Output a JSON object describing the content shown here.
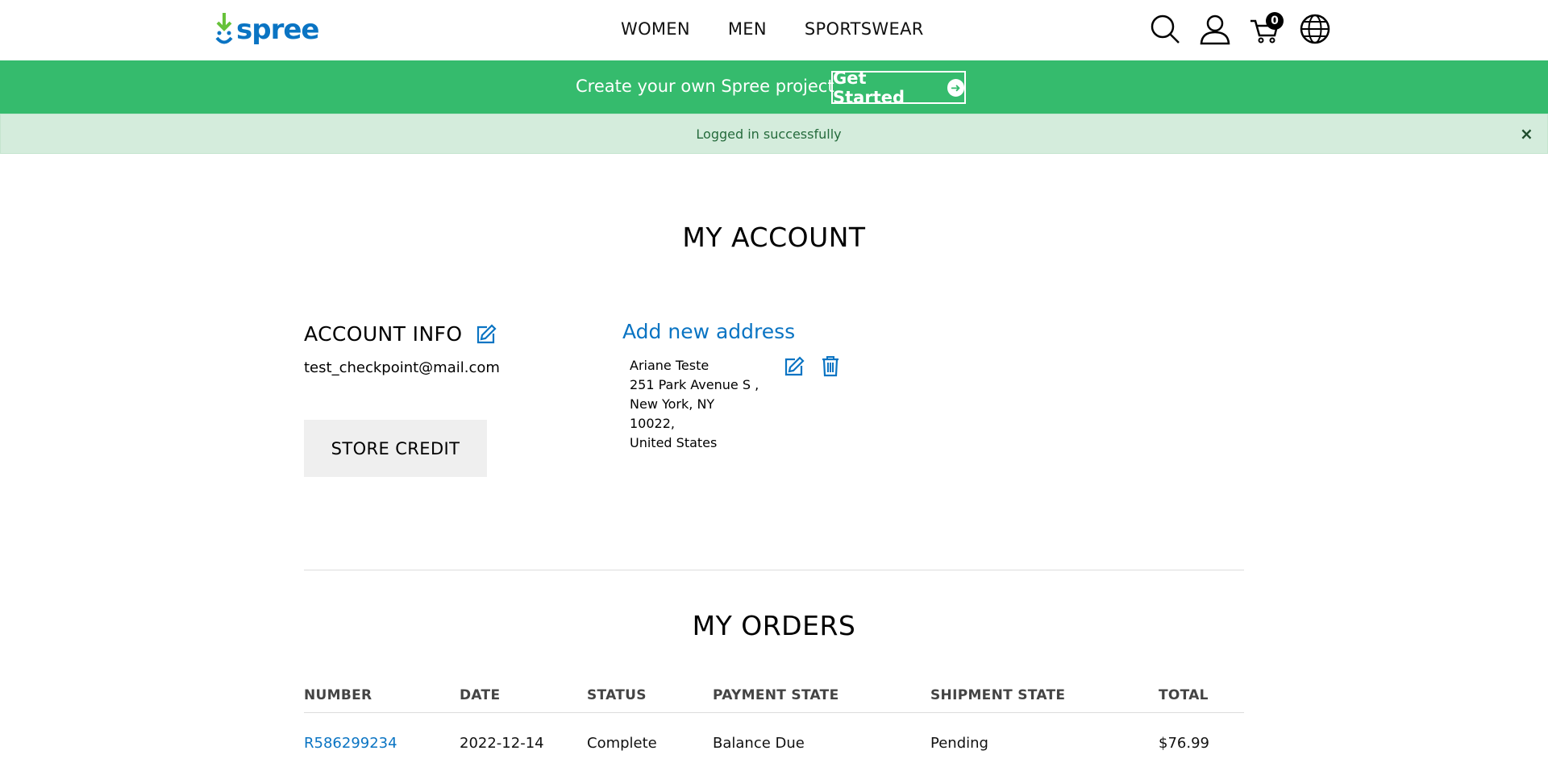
{
  "header": {
    "logo_text": "spree",
    "nav": [
      "WOMEN",
      "MEN",
      "SPORTSWEAR"
    ],
    "cart_count": "0",
    "icons": [
      "search-icon",
      "account-icon",
      "cart-icon",
      "globe-icon"
    ]
  },
  "promo": {
    "text": "Create your own Spree project",
    "button_label": "Get Started",
    "button_icon": "arrow-right-circle-icon",
    "bg_color": "#35bb6d"
  },
  "flash": {
    "message": "Logged in successfully",
    "close_label": "×"
  },
  "main": {
    "title": "MY ACCOUNT",
    "account_info": {
      "title": "ACCOUNT INFO",
      "email": "test_checkpoint@mail.com",
      "store_credit_label": "STORE CREDIT"
    },
    "addresses": {
      "add_label": "Add new address",
      "items": [
        {
          "name": "Ariane Teste",
          "street": "251 Park Avenue S ,",
          "city_state": "New York, NY",
          "zip": "10022,",
          "country": "United States"
        }
      ]
    }
  },
  "orders": {
    "title": "MY ORDERS",
    "columns": [
      "NUMBER",
      "DATE",
      "STATUS",
      "PAYMENT STATE",
      "SHIPMENT STATE",
      "TOTAL"
    ],
    "rows": [
      {
        "number": "R586299234",
        "date": "2022-12-14",
        "status": "Complete",
        "payment_state": "Balance Due",
        "shipment_state": "Pending",
        "total": "$76.99"
      }
    ]
  },
  "colors": {
    "link": "#0a74c3",
    "flash_bg": "#d4ecdc"
  }
}
